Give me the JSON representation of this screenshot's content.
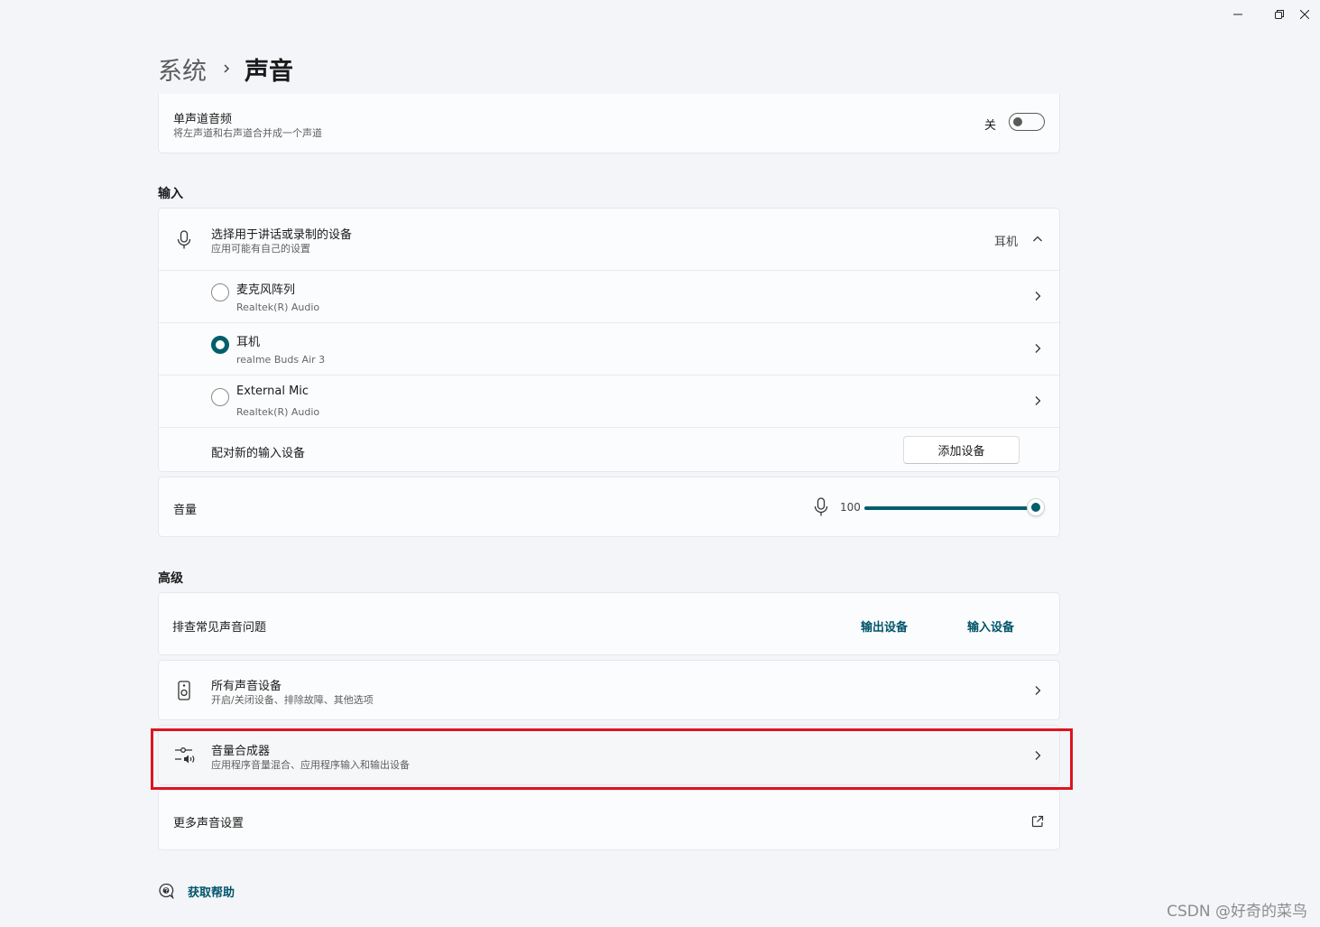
{
  "window": {
    "minimize_icon": "minimize-icon",
    "restore_icon": "restore-icon",
    "close_icon": "close-icon"
  },
  "breadcrumb": {
    "parent": "系统",
    "current": "声音"
  },
  "mono_audio": {
    "title": "单声道音频",
    "subtitle": "将左声道和右声道合并成一个声道",
    "state_label": "关",
    "enabled": false
  },
  "input_section": {
    "label": "输入",
    "device_select": {
      "title": "选择用于讲话或录制的设备",
      "subtitle": "应用可能有自己的设置",
      "selected": "耳机"
    },
    "devices": [
      {
        "name": "麦克风阵列",
        "detail": "Realtek(R) Audio",
        "selected": false
      },
      {
        "name": "耳机",
        "detail": "realme Buds Air 3",
        "selected": true
      },
      {
        "name": "External Mic",
        "detail": "Realtek(R) Audio",
        "selected": false
      }
    ],
    "pair": {
      "label": "配对新的输入设备",
      "button": "添加设备"
    },
    "volume": {
      "label": "音量",
      "value": "100",
      "level_percent": 100
    }
  },
  "advanced_section": {
    "label": "高级",
    "troubleshoot": {
      "label": "排查常见声音问题",
      "output_link": "输出设备",
      "input_link": "输入设备"
    },
    "all_devices": {
      "title": "所有声音设备",
      "subtitle": "开启/关闭设备、排除故障、其他选项"
    },
    "mixer": {
      "title": "音量合成器",
      "subtitle": "应用程序音量混合、应用程序输入和输出设备"
    },
    "more": {
      "label": "更多声音设置"
    }
  },
  "help": {
    "label": "获取帮助"
  },
  "watermark": "CSDN @好奇的菜鸟",
  "colors": {
    "accent": "#005f6b",
    "highlight": "#e0131f"
  }
}
